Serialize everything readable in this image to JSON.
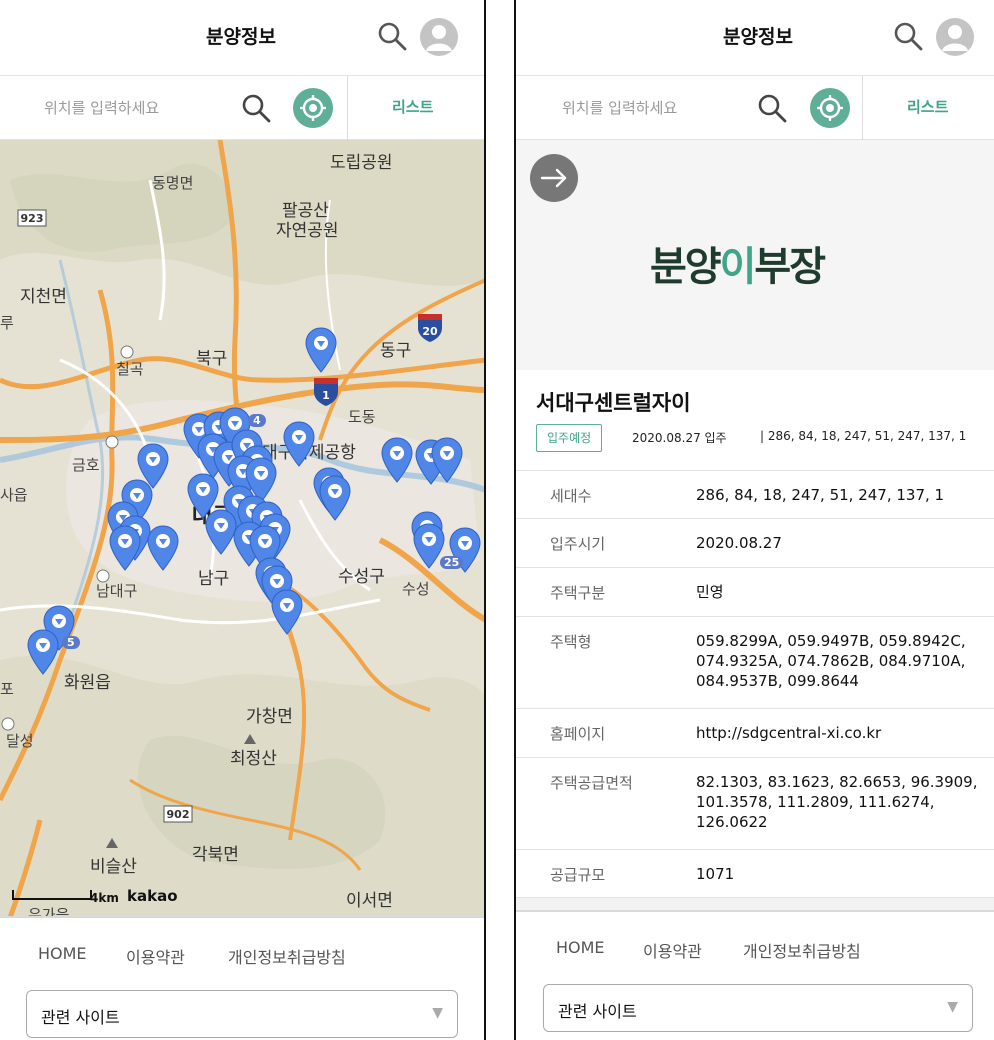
{
  "header": {
    "title": "분양정보"
  },
  "location": {
    "placeholder": "위치를 입력하세요",
    "list_label": "리스트"
  },
  "map": {
    "labels": {
      "dorip_park": "도립공원",
      "dongmyeon": "동명면",
      "palgongsan": "팔공산",
      "nature_park": "자연공원",
      "jicheonmyeon": "지천면",
      "bukgu": "북구",
      "chilgok": "칠곡",
      "donggu": "동구",
      "dongchon": "도동",
      "daegu_airport": "대구국제공항",
      "geumho": "금호",
      "city_hall": "대구시청",
      "namgu": "남구",
      "suseonggu": "수성구",
      "suseong": "수성",
      "seodaegu": "남대구",
      "hwawon": "화원읍",
      "dalseong": "달성",
      "gachang": "가창면",
      "choijeongsan": "최정산",
      "biseulsan": "비슬산",
      "gakbuk": "각북면",
      "iseomyeon": "이서면",
      "sangju": "사읍",
      "ugaeup": "유가읍",
      "left_edge_po": "포",
      "left_edge_ru": "루"
    },
    "route_shields": {
      "r923": "923",
      "r20": "20",
      "r1": "1",
      "r902": "902"
    },
    "cluster_counts": {
      "c4": "4",
      "c5": "5",
      "c25": "25"
    },
    "scale_label": "4km",
    "attribution": "kakao"
  },
  "footer": {
    "links": [
      "HOME",
      "이용약관",
      "개인정보취급방침"
    ],
    "related_sites_label": "관련 사이트",
    "caret": "▼"
  },
  "detail": {
    "logo_text": "분양이부장",
    "logo_parts": [
      "분양",
      "이",
      "부장"
    ],
    "title": "서대구센트럴자이",
    "status_badge": "입주예정",
    "movein_brief": "2020.08.27 입주",
    "household_brief": "| 286, 84, 18, 247, 51, 247, 137, 1",
    "rows": [
      {
        "label": "세대수",
        "value": "286, 84, 18, 247, 51, 247, 137, 1"
      },
      {
        "label": "입주시기",
        "value": "2020.08.27"
      },
      {
        "label": "주택구분",
        "value": "민영"
      },
      {
        "label": "주택형",
        "value": "059.8299A, 059.9497B, 059.8942C, 074.9325A, 074.7862B, 084.9710A, 084.9537B, 099.8644"
      },
      {
        "label": "홈페이지",
        "value": "http://sdgcentral-xi.co.kr"
      },
      {
        "label": "주택공급면적",
        "value": "82.1303, 83.1623, 82.6653, 96.3909, 101.3578, 111.2809, 111.6274, 126.0622"
      },
      {
        "label": "공급규모",
        "value": "1071"
      }
    ]
  },
  "colors": {
    "accent": "#5fae96",
    "accent_text": "#3fa488",
    "pin": "#4f86e8",
    "road_orange": "#f0a54a",
    "logo_dark": "#1f3b2e"
  }
}
